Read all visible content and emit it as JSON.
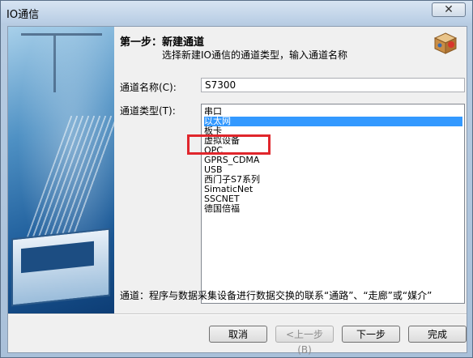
{
  "window": {
    "title": "IO通信",
    "close_glyph": "✕"
  },
  "header": {
    "step": "第一步：新建通道",
    "description": "选择新建IO通信的通道类型，输入通道名称"
  },
  "form": {
    "name_label": "通道名称(C):",
    "name_value": "S7300",
    "type_label": "通道类型(T):",
    "types": [
      "串口",
      "以太网",
      "板卡",
      "虚拟设备",
      "OPC",
      "GPRS_CDMA",
      "USB",
      "西门子S7系列",
      "SimaticNet",
      "SSCNET",
      "德国倍福"
    ],
    "selected_index": 1
  },
  "description_text": "通道：程序与数据采集设备进行数据交换的联系“通路”、“走廊”或“媒介”",
  "buttons": {
    "cancel": "取消",
    "prev": "<上一步(B)",
    "next": "下一步",
    "finish": "完成"
  },
  "colors": {
    "selection": "#3399ff",
    "annotation": "#e0262c"
  }
}
